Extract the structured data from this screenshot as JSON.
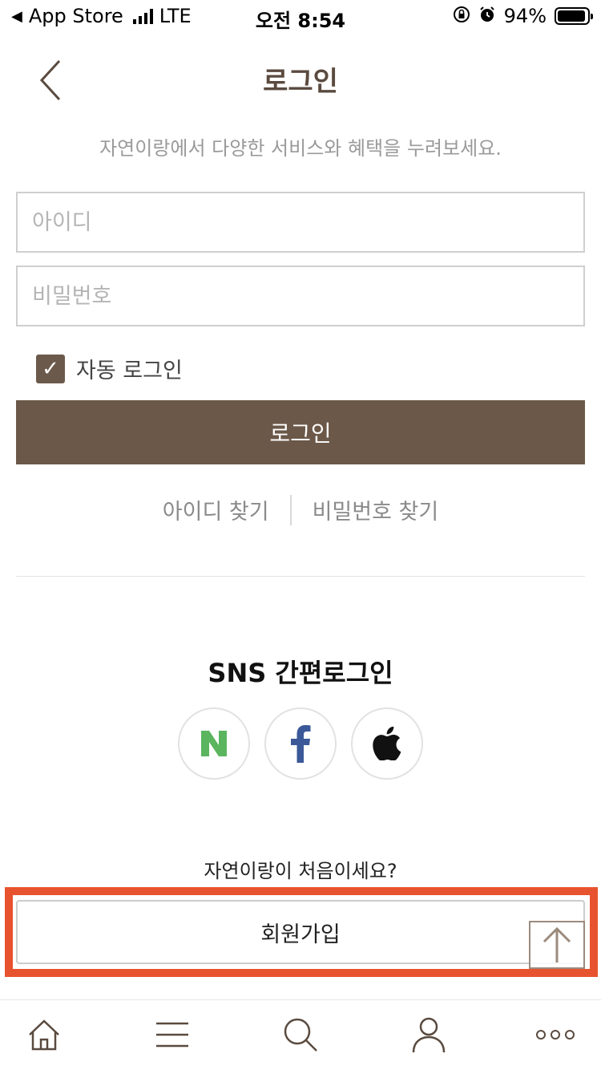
{
  "status_bar": {
    "back_app": "App Store",
    "network": "LTE",
    "time": "오전 8:54",
    "battery_percent_text": "94%",
    "battery_level": 0.94
  },
  "header": {
    "title": "로그인",
    "subtitle": "자연이랑에서 다양한 서비스와 혜택을 누려보세요."
  },
  "form": {
    "id_placeholder": "아이디",
    "id_value": "",
    "password_placeholder": "비밀번호",
    "password_value": "",
    "auto_login_label": "자동 로그인",
    "auto_login_checked": true,
    "login_button": "로그인"
  },
  "find_links": {
    "find_id": "아이디 찾기",
    "find_password": "비밀번호 찾기"
  },
  "sns": {
    "title": "SNS 간편로그인",
    "providers": [
      {
        "name": "naver",
        "icon": "naver-icon",
        "color": "#5ab55e"
      },
      {
        "name": "facebook",
        "icon": "facebook-icon",
        "color": "#3b5998"
      },
      {
        "name": "apple",
        "icon": "apple-icon",
        "color": "#111111"
      }
    ]
  },
  "signup": {
    "prompt": "자연이랑이 처음이세요?",
    "button": "회원가입"
  },
  "colors": {
    "accent": "#6b5848",
    "title": "#5a4a3f",
    "highlight": "#e8532f"
  },
  "bottom_nav": [
    {
      "icon": "home-icon"
    },
    {
      "icon": "menu-icon"
    },
    {
      "icon": "search-icon"
    },
    {
      "icon": "user-icon"
    },
    {
      "icon": "more-icon"
    }
  ]
}
